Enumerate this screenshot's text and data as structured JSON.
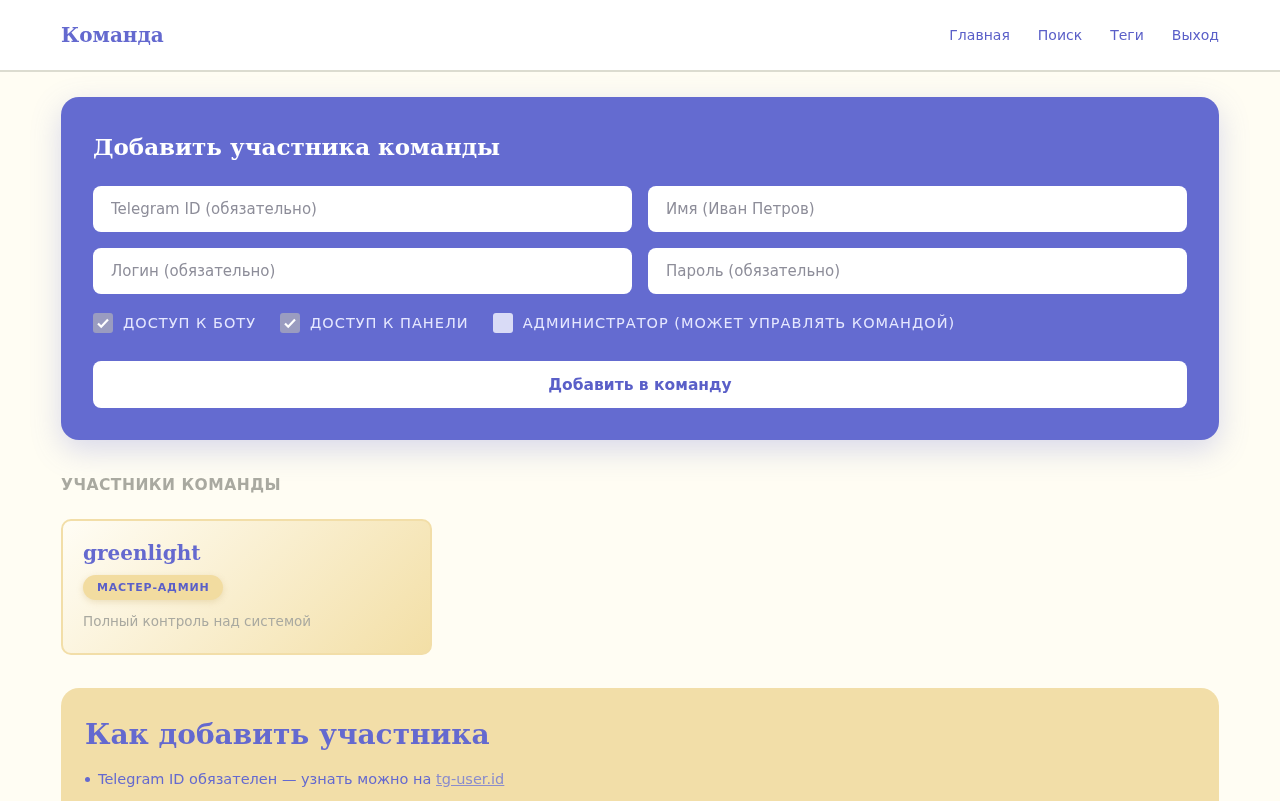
{
  "header": {
    "logo": "Команда",
    "nav": [
      "Главная",
      "Поиск",
      "Теги",
      "Выход"
    ]
  },
  "add_form": {
    "title": "Добавить участника команды",
    "fields": [
      {
        "placeholder": "Telegram ID (обязательно)"
      },
      {
        "placeholder": "Имя (Иван Петров)"
      },
      {
        "placeholder": "Логин (обязательно)"
      },
      {
        "placeholder": "Пароль (обязательно)"
      }
    ],
    "checkboxes": [
      {
        "label": "ДОСТУП К БОТУ",
        "checked": true
      },
      {
        "label": "ДОСТУП К ПАНЕЛИ",
        "checked": true
      },
      {
        "label": "АДМИНИСТРАТОР (МОЖЕТ УПРАВЛЯТЬ КОМАНДОЙ)",
        "checked": false
      }
    ],
    "submit": "Добавить в команду"
  },
  "members": {
    "title": "УЧАСТНИКИ КОМАНДЫ",
    "items": [
      {
        "name": "greenlight",
        "role": "МАСТЕР-АДМИН",
        "description": "Полный контроль над системой"
      }
    ]
  },
  "help": {
    "title": "Как добавить участника",
    "items": [
      {
        "text": "Telegram ID обязателен — узнать можно на ",
        "link": "tg-user.id"
      }
    ]
  }
}
